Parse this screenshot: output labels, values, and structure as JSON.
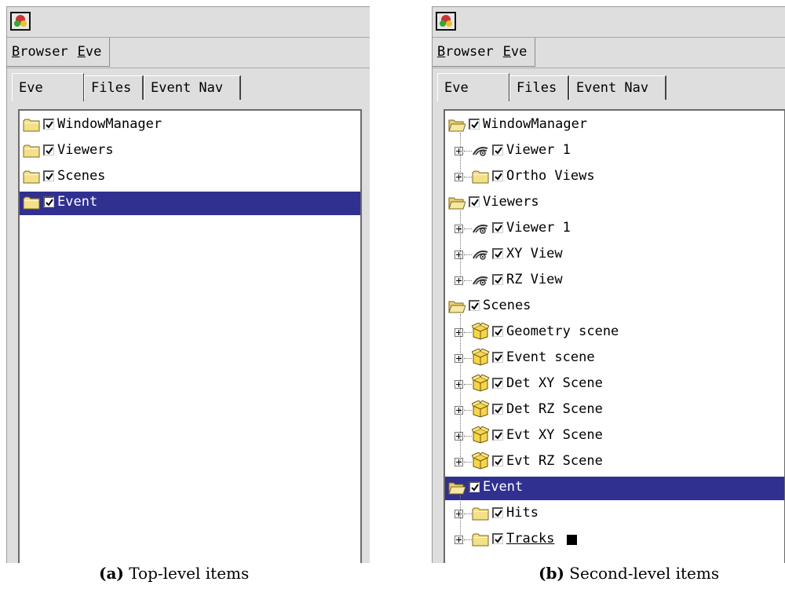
{
  "menus": [
    {
      "label": "Browser",
      "key": "B"
    },
    {
      "label": "Eve",
      "key": "E"
    }
  ],
  "tabs": [
    "Eve",
    "Files",
    "Event Nav"
  ],
  "panel_a": {
    "items": [
      {
        "label": "WindowManager",
        "icon": "folder-closed-icon",
        "checked": true
      },
      {
        "label": "Viewers",
        "icon": "folder-closed-icon",
        "checked": true
      },
      {
        "label": "Scenes",
        "icon": "folder-closed-icon",
        "checked": true
      },
      {
        "label": "Event",
        "icon": "folder-closed-icon",
        "checked": true,
        "selected": true
      }
    ]
  },
  "panel_b": {
    "items": [
      {
        "label": "WindowManager",
        "icon": "folder-open-icon",
        "level": 0,
        "checked": true
      },
      {
        "label": "Viewer 1",
        "icon": "viewer-eye-icon",
        "level": 1,
        "checked": true
      },
      {
        "label": "Ortho Views",
        "icon": "folder-closed-icon",
        "level": 1,
        "checked": true
      },
      {
        "label": "Viewers",
        "icon": "folder-open-icon",
        "level": 0,
        "checked": true
      },
      {
        "label": "Viewer 1",
        "icon": "viewer-eye-icon",
        "level": 1,
        "checked": true
      },
      {
        "label": "XY View",
        "icon": "viewer-eye-icon",
        "level": 1,
        "checked": true
      },
      {
        "label": "RZ View",
        "icon": "viewer-eye-icon",
        "level": 1,
        "checked": true
      },
      {
        "label": "Scenes",
        "icon": "folder-open-icon",
        "level": 0,
        "checked": true
      },
      {
        "label": "Geometry scene",
        "icon": "scene-box-icon",
        "level": 1,
        "checked": true
      },
      {
        "label": "Event scene",
        "icon": "scene-box-icon",
        "level": 1,
        "checked": true
      },
      {
        "label": "Det XY Scene",
        "icon": "scene-box-icon",
        "level": 1,
        "checked": true
      },
      {
        "label": "Det RZ Scene",
        "icon": "scene-box-icon",
        "level": 1,
        "checked": true
      },
      {
        "label": "Evt XY Scene",
        "icon": "scene-box-icon",
        "level": 1,
        "checked": true
      },
      {
        "label": "Evt RZ Scene",
        "icon": "scene-box-icon",
        "level": 1,
        "checked": true
      },
      {
        "label": "Event",
        "icon": "folder-open-icon",
        "level": 0,
        "checked": true,
        "selected": true
      },
      {
        "label": "Hits",
        "icon": "folder-closed-icon",
        "level": 1,
        "checked": true
      },
      {
        "label": "Tracks",
        "icon": "folder-closed-icon",
        "level": 1,
        "checked": true,
        "underlined": true,
        "color_marker": "#000000"
      }
    ]
  },
  "captions": {
    "a": {
      "tag": "(a)",
      "text": "Top-level items"
    },
    "b": {
      "tag": "(b)",
      "text": "Second-level items"
    }
  },
  "colors": {
    "selection": "#303090",
    "folder": "#f5e08a",
    "scene_box": "#f7d54a"
  }
}
